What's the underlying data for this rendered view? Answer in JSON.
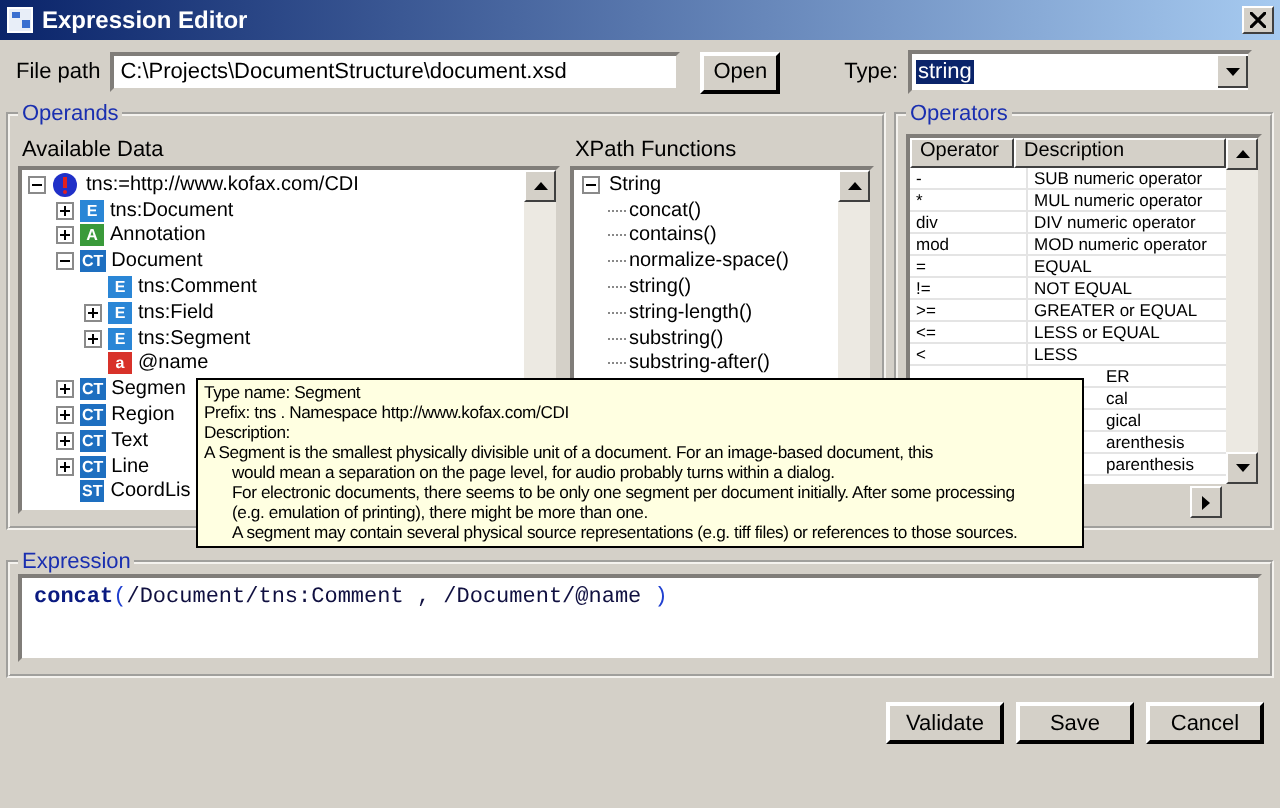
{
  "window": {
    "title": "Expression Editor"
  },
  "file_path": {
    "label": "File path",
    "value": "C:\\Projects\\DocumentStructure\\document.xsd",
    "button": "Open"
  },
  "type": {
    "label": "Type:",
    "value": "string"
  },
  "operands": {
    "title": "Operands",
    "available_data": {
      "label": "Available Data",
      "tree": [
        {
          "text": "tns:=http://www.kofax.com/CDI",
          "kind": "namespace",
          "expanded": true,
          "children": [
            {
              "text": "tns:Document",
              "kind": "element",
              "badge": "E",
              "expanded": false
            },
            {
              "text": "Annotation",
              "kind": "group",
              "badge": "A",
              "expanded": false
            },
            {
              "text": "Document",
              "kind": "complex",
              "badge": "CT",
              "expanded": true,
              "children": [
                {
                  "text": "tns:Comment",
                  "kind": "element",
                  "badge": "E"
                },
                {
                  "text": "tns:Field",
                  "kind": "element",
                  "badge": "E",
                  "expanded": false
                },
                {
                  "text": "tns:Segment",
                  "kind": "element",
                  "badge": "E",
                  "expanded": false
                },
                {
                  "text": "@name",
                  "kind": "attribute",
                  "badge": "a"
                }
              ]
            },
            {
              "text": "Segmen",
              "kind": "complex",
              "badge": "CT",
              "expanded": false
            },
            {
              "text": "Region",
              "kind": "complex",
              "badge": "CT",
              "expanded": false
            },
            {
              "text": "Text",
              "kind": "complex",
              "badge": "CT",
              "expanded": false
            },
            {
              "text": "Line",
              "kind": "complex",
              "badge": "CT",
              "expanded": false
            },
            {
              "text": "CoordLis",
              "kind": "simple",
              "badge": "ST"
            }
          ]
        }
      ]
    },
    "xpath_functions": {
      "label": "XPath Functions",
      "tree": [
        {
          "text": "String",
          "expanded": true,
          "children": [
            {
              "text": "concat()"
            },
            {
              "text": "contains()"
            },
            {
              "text": "normalize-space()"
            },
            {
              "text": "string()"
            },
            {
              "text": "string-length()"
            },
            {
              "text": "substring()"
            },
            {
              "text": "substring-after()"
            }
          ]
        }
      ]
    }
  },
  "operators": {
    "title": "Operators",
    "columns": [
      "Operator",
      "Description"
    ],
    "rows": [
      {
        "operator": "-",
        "description": "SUB  numeric operator"
      },
      {
        "operator": "*",
        "description": "MUL numeric  operator"
      },
      {
        "operator": "div",
        "description": "DIV numeric operator"
      },
      {
        "operator": "mod",
        "description": "MOD numeric   operator"
      },
      {
        "operator": "=",
        "description": "EQUAL"
      },
      {
        "operator": "!=",
        "description": "NOT EQUAL"
      },
      {
        "operator": ">=",
        "description": "GREATER or EQUAL"
      },
      {
        "operator": "<=",
        "description": "LESS or EQUAL"
      },
      {
        "operator": "<",
        "description": "LESS"
      },
      {
        "description": "ER"
      },
      {
        "description": "cal"
      },
      {
        "description": "gical"
      },
      {
        "description": "arenthesis"
      },
      {
        "description": "parenthesis"
      }
    ]
  },
  "tooltip": {
    "lines": [
      "Type name: Segment",
      "Prefix: tns . Namespace http://www.kofax.com/CDI",
      "Description:"
    ],
    "description": [
      "A Segment is the smallest physically divisible unit of a document. For an image-based document, this",
      "would mean a separation on the page level, for audio probably turns within a dialog.",
      "For electronic documents, there seems to be only one segment per document initially. After some processing",
      "(e.g. emulation of printing), there might be more than one.",
      "A segment may contain several physical source representations (e.g. tiff files) or references to those sources."
    ]
  },
  "expression": {
    "title": "Expression",
    "parts": [
      {
        "kind": "function",
        "text": "concat"
      },
      {
        "kind": "paren",
        "text": "("
      },
      {
        "kind": "path",
        "text": "/Document/tns:Comment , /Document/@name "
      },
      {
        "kind": "paren",
        "text": ")"
      }
    ]
  },
  "buttons": [
    "Validate",
    "Save",
    "Cancel"
  ]
}
